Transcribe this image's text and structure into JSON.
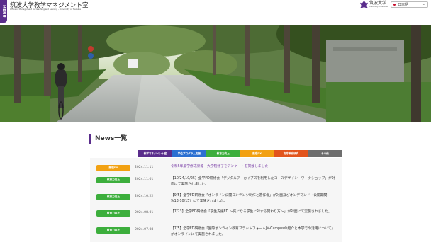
{
  "menu_tab": {
    "label": "MENU"
  },
  "header": {
    "site_title": "筑波大学教学マネジメント室",
    "site_subtitle": "Office of Management for teaching and Leaning – University of Tsukuba",
    "university_name": "筑波大学",
    "university_name_en": "University of Tsukuba",
    "language_select": {
      "value": "日本語"
    }
  },
  "news": {
    "heading": "News一覧",
    "tabs": [
      {
        "label": "教学マネジメント室",
        "color": "#5a2d8c"
      },
      {
        "label": "学位プログラム支援",
        "color": "#2b6fd1"
      },
      {
        "label": "教育力向上",
        "color": "#3cae3c"
      },
      {
        "label": "数理DX",
        "color": "#f2a112"
      },
      {
        "label": "高等教育研究",
        "color": "#e2541c"
      },
      {
        "label": "その他",
        "color": "#6e6e6e"
      }
    ],
    "items": [
      {
        "badge": "数理DX",
        "badge_color": "#f2a112",
        "date": "2024.11.11",
        "title": "令和5年度学修成果等・大学院修了をアンケートを掲載しました"
      },
      {
        "badge": "教育力向上",
        "badge_color": "#3cae3c",
        "date": "2024.11.01",
        "title": "【10/24,10/25】全学FD研修会「デジタルアーカイブズを利用したコースデザイン・ワークショップ」が対面にて実施されました。"
      },
      {
        "badge": "教育力向上",
        "badge_color": "#3cae3c",
        "date": "2024.10.22",
        "title": "【9/5】全学FD研修会「オンライン公開コンテンツ制作と著作権」が対面及びオンデマンド（公開期間：9/13-10/15）にて実施されました。"
      },
      {
        "badge": "教育力向上",
        "badge_color": "#3cae3c",
        "date": "2024.08.01",
        "title": "【7/23】全学FD研修会「学生支援FD ～気になる学生に対する関わり方～」が対面にて実施されました。"
      },
      {
        "badge": "教育力向上",
        "badge_color": "#3cae3c",
        "date": "2024.07.08",
        "title": "【7/5】全学FD研修会「国際オンライン教育プラットフォームJV-Campusの紹介と本学での活用について」がオンラインにて実施されました。"
      }
    ]
  }
}
